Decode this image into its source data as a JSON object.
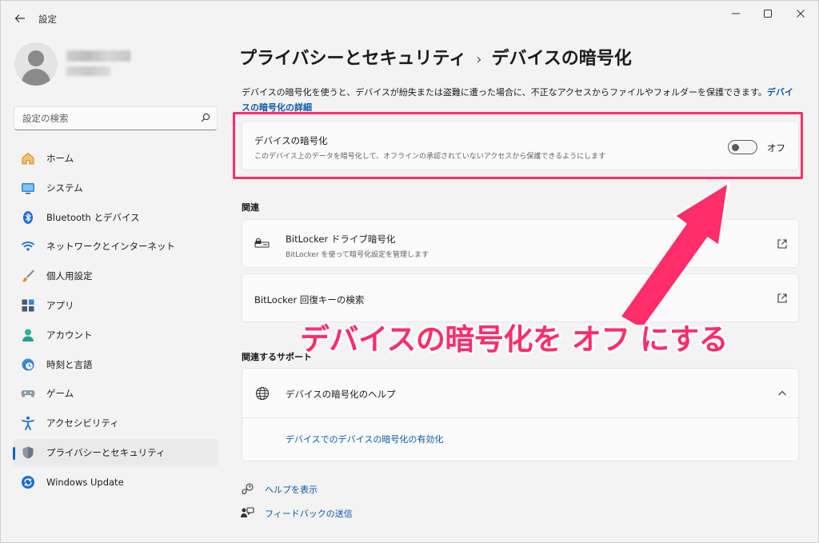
{
  "window": {
    "title": "設定",
    "back_icon": "back-arrow-icon",
    "controls": [
      "minimize-icon",
      "maximize-icon",
      "close-icon"
    ]
  },
  "sidebar": {
    "search_placeholder": "設定の検索",
    "items": [
      {
        "label": "ホーム",
        "icon": "home-icon"
      },
      {
        "label": "システム",
        "icon": "system-icon"
      },
      {
        "label": "Bluetooth とデバイス",
        "icon": "bluetooth-icon"
      },
      {
        "label": "ネットワークとインターネット",
        "icon": "wifi-icon"
      },
      {
        "label": "個人用設定",
        "icon": "brush-icon"
      },
      {
        "label": "アプリ",
        "icon": "apps-icon"
      },
      {
        "label": "アカウント",
        "icon": "account-icon"
      },
      {
        "label": "時刻と言語",
        "icon": "time-language-icon"
      },
      {
        "label": "ゲーム",
        "icon": "gamepad-icon"
      },
      {
        "label": "アクセシビリティ",
        "icon": "accessibility-icon"
      },
      {
        "label": "プライバシーとセキュリティ",
        "icon": "shield-icon",
        "active": true
      },
      {
        "label": "Windows Update",
        "icon": "update-icon"
      }
    ]
  },
  "main": {
    "breadcrumb_parent": "プライバシーとセキュリティ",
    "breadcrumb_sep": "›",
    "breadcrumb_current": "デバイスの暗号化",
    "description": "デバイスの暗号化を使うと、デバイスが紛失または盗難に遭った場合に、不正なアクセスからファイルやフォルダーを保護できます。",
    "description_link": "デバイスの暗号化の詳細",
    "encryption_card": {
      "title": "デバイスの暗号化",
      "subtitle": "このデバイス上のデータを暗号化して、オフラインの承認されていないアクセスから保護できるようにします",
      "toggle_state": "オフ",
      "toggle_on": false
    },
    "related_label": "関連",
    "bitlocker_card": {
      "title": "BitLocker ドライブ暗号化",
      "subtitle": "BitLocker を使って暗号化設定を管理します"
    },
    "recovery_card": {
      "title": "BitLocker 回復キーの検索"
    },
    "support_label": "関連するサポート",
    "help_card": {
      "title": "デバイスの暗号化のヘルプ",
      "link": "デバイスでのデバイスの暗号化の有効化"
    },
    "footer": {
      "help": "ヘルプを表示",
      "feedback": "フィードバックの送信"
    }
  },
  "annotation": {
    "text": "デバイスの暗号化を オフ にする",
    "color": "#ff2d6a"
  },
  "colors": {
    "accent": "#0067c0",
    "link": "#0b59a8",
    "highlight": "#ff2d6a",
    "background": "#f3f3f3"
  }
}
